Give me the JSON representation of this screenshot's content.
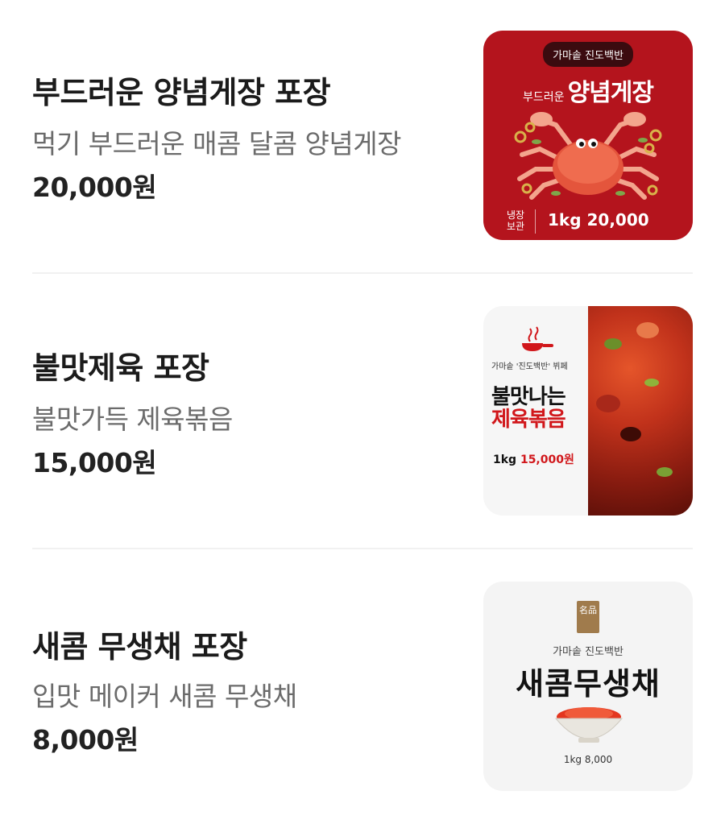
{
  "menu": {
    "items": [
      {
        "name": "부드러운 양념게장 포장",
        "description": "먹기 부드러운 매콤 달콤 양념게장",
        "price": "20,000원",
        "thumbnail": {
          "brand": "가마솥 진도백반",
          "subtitle": "부드러운",
          "title": "양념게장",
          "storage": "냉장 보관",
          "price": "1kg 20,000",
          "bg_color": "#b4141d"
        }
      },
      {
        "name": "불맛제육 포장",
        "description": "불맛가득 제육볶음",
        "price": "15,000원",
        "thumbnail": {
          "brand": "가마솥 '진도백반' 뷔페",
          "title_line1": "불맛나는",
          "title_line2": "제육볶음",
          "weight": "1kg",
          "price": "15,000원",
          "accent_color": "#d1171b"
        }
      },
      {
        "name": "새콤 무생채 포장",
        "description": "입맛 메이커 새콤 무생채",
        "price": "8,000원",
        "thumbnail": {
          "badge": "名品",
          "brand": "가마솥 진도백반",
          "title": "새콤무생채",
          "price": "1kg 8,000"
        }
      }
    ]
  }
}
